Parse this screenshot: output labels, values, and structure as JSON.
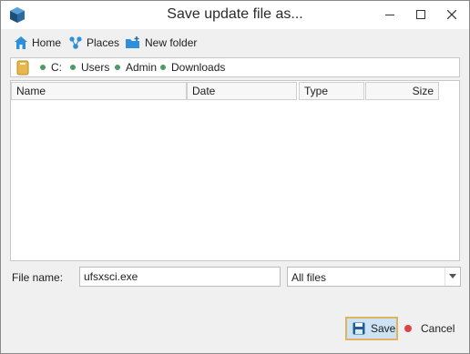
{
  "window": {
    "title": "Save update file as..."
  },
  "toolbar": {
    "home_label": "Home",
    "places_label": "Places",
    "new_folder_label": "New folder"
  },
  "breadcrumb": {
    "segments": [
      "C:",
      "Users",
      "Admin",
      "Downloads"
    ]
  },
  "file_list": {
    "columns": [
      "Name",
      "Date",
      "Type",
      "Size"
    ],
    "rows": []
  },
  "form": {
    "file_name_label": "File name:",
    "file_name_value": "ufsxsci.exe",
    "file_type_selected": "All files"
  },
  "buttons": {
    "save_label": "Save",
    "cancel_label": "Cancel"
  },
  "colors": {
    "accent": "#2f8fd8",
    "save_bg": "#cde3f3",
    "save_border": "#e0b45f",
    "breadcrumb_dot": "#4f9a65",
    "cancel_dot": "#e0424a"
  }
}
